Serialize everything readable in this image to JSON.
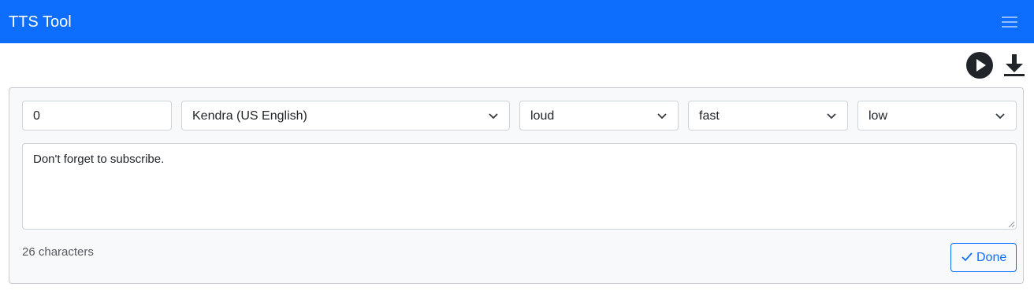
{
  "app": {
    "title": "TTS Tool"
  },
  "toolbar": {
    "play_icon": "play-circle-icon",
    "download_icon": "download-icon"
  },
  "form": {
    "number_value": "0",
    "voice_selected": "Kendra (US English)",
    "volume_selected": "loud",
    "rate_selected": "fast",
    "pitch_selected": "low",
    "text_value": "Don't forget to subscribe.",
    "char_count": "26 characters",
    "done_label": "Done"
  },
  "colors": {
    "navbar": "#0d6efd",
    "accent": "#0d6efd"
  }
}
